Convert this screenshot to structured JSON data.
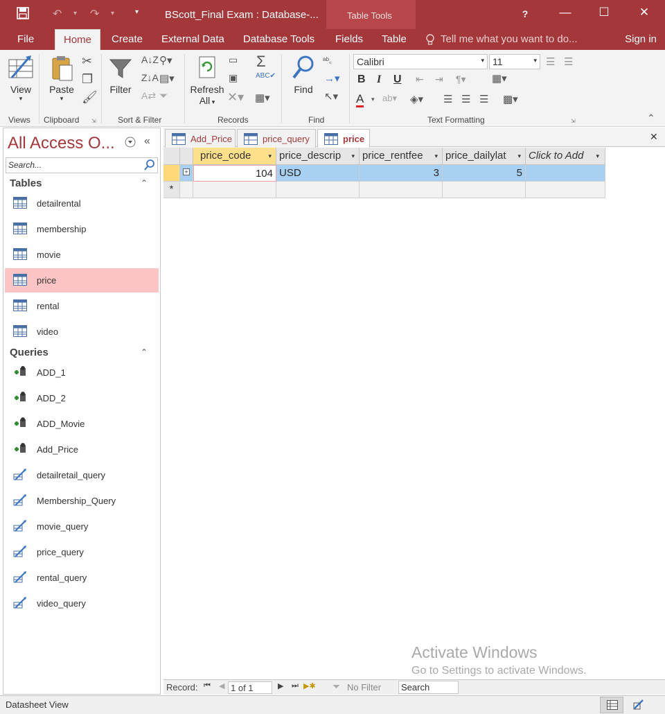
{
  "window": {
    "title": "BScott_Final Exam : Database-...",
    "context_tab_group": "Table Tools",
    "help": "?",
    "minimize": "—",
    "maximize": "☐",
    "close": "✕"
  },
  "ribbon_tabs": [
    "File",
    "Home",
    "Create",
    "External Data",
    "Database Tools",
    "Fields",
    "Table"
  ],
  "tell_me": "Tell me what you want to do...",
  "sign_in": "Sign in",
  "ribbon": {
    "views": {
      "label": "Views",
      "view_button": "View"
    },
    "clipboard": {
      "label": "Clipboard",
      "paste_button": "Paste"
    },
    "sort_filter": {
      "label": "Sort & Filter",
      "filter_button": "Filter"
    },
    "records": {
      "label": "Records",
      "refresh_button_1": "Refresh",
      "refresh_button_2": "All"
    },
    "find": {
      "label": "Find",
      "find_button": "Find"
    },
    "text_formatting": {
      "label": "Text Formatting",
      "font_name": "Calibri",
      "font_size": "11",
      "bold": "B",
      "italic": "I",
      "underline": "U",
      "font_color": "A"
    }
  },
  "nav_pane": {
    "title": "All Access O...",
    "search_placeholder": "Search...",
    "tables_header": "Tables",
    "tables": [
      "detailrental",
      "membership",
      "movie",
      "price",
      "rental",
      "video"
    ],
    "selected_table": "price",
    "queries_header": "Queries",
    "queries": [
      {
        "name": "ADD_1",
        "kind": "append"
      },
      {
        "name": "ADD_2",
        "kind": "append"
      },
      {
        "name": "ADD_Movie",
        "kind": "append"
      },
      {
        "name": "Add_Price",
        "kind": "append"
      },
      {
        "name": "detailretail_query",
        "kind": "select"
      },
      {
        "name": "Membership_Query",
        "kind": "select"
      },
      {
        "name": "movie_query",
        "kind": "select"
      },
      {
        "name": "price_query",
        "kind": "select"
      },
      {
        "name": "rental_query",
        "kind": "select"
      },
      {
        "name": "video_query",
        "kind": "select"
      }
    ]
  },
  "doc_tabs": [
    {
      "label": "Add_Price",
      "active": false
    },
    {
      "label": "price_query",
      "active": false
    },
    {
      "label": "price",
      "active": true
    }
  ],
  "datasheet": {
    "columns": [
      "price_code",
      "price_descrip",
      "price_rentfee",
      "price_dailylat",
      "Click to Add"
    ],
    "rows": [
      [
        "104",
        "USD",
        "3",
        "5",
        ""
      ]
    ],
    "new_row_marker": "*",
    "expand_marker": "+"
  },
  "record_nav": {
    "label": "Record:",
    "position": "1 of 1",
    "filter": "No Filter",
    "search": "Search"
  },
  "status_bar": {
    "text": "Datasheet View"
  },
  "watermark": {
    "line1": "Activate Windows",
    "line2": "Go to Settings to activate Windows."
  },
  "colors": {
    "accent": "#a4373a",
    "selection": "#a8d0f2",
    "nav_selected": "#fcc4c4"
  }
}
